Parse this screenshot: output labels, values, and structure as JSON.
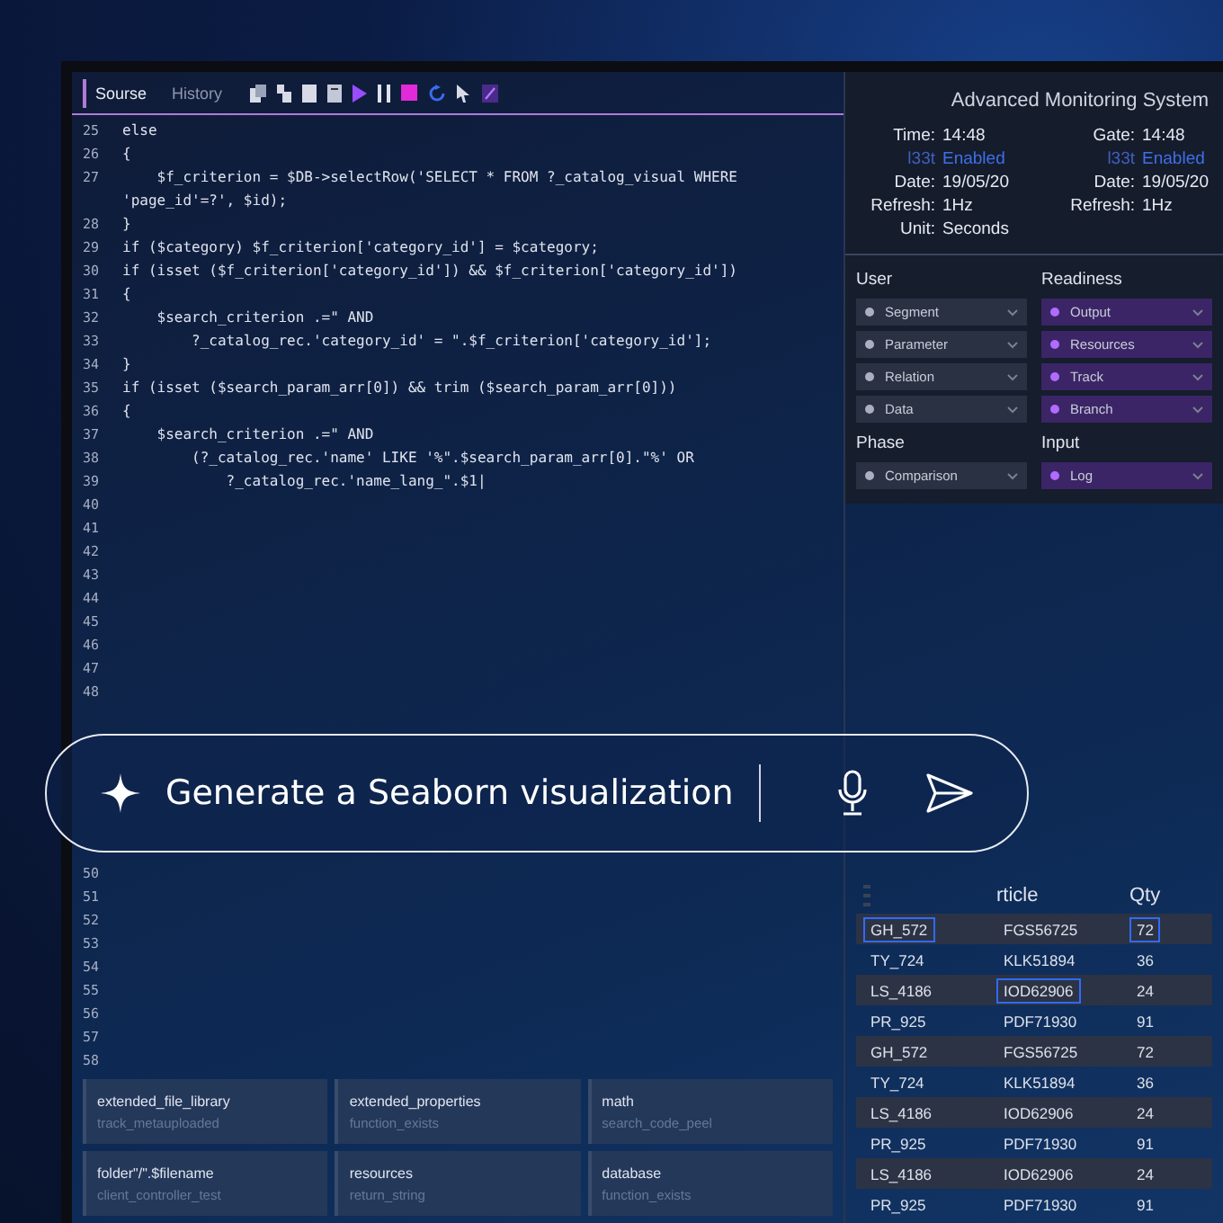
{
  "editor": {
    "tabs": [
      {
        "label": "Sourse",
        "selected": true
      },
      {
        "label": "History",
        "selected": false
      }
    ],
    "lines_above": [
      {
        "number": "25",
        "code": "else"
      },
      {
        "number": "26",
        "code": "{"
      },
      {
        "number": "27",
        "code": "    $f_criterion = $DB->selectRow('SELECT * FROM ?_catalog_visual WHERE 'page_id'=?', $id);"
      },
      {
        "number": "28",
        "code": "}"
      },
      {
        "number": "29",
        "code": "if ($category) $f_criterion['category_id'] = $category;"
      },
      {
        "number": "30",
        "code": "if (isset ($f_criterion['category_id']) && $f_criterion['category_id'])"
      },
      {
        "number": "31",
        "code": "{"
      },
      {
        "number": "32",
        "code": "    $search_criterion .=\" AND"
      },
      {
        "number": "33",
        "code": "        ?_catalog_rec.'category_id' = \".$f_criterion['category_id'];"
      },
      {
        "number": "34",
        "code": "}"
      },
      {
        "number": "35",
        "code": "if (isset ($search_param_arr[0]) && trim ($search_param_arr[0]))"
      },
      {
        "number": "36",
        "code": "{"
      },
      {
        "number": "37",
        "code": "    $search_criterion .=\" AND"
      },
      {
        "number": "38",
        "code": "        (?_catalog_rec.'name' LIKE '%\".$search_param_arr[0].\"%' OR"
      },
      {
        "number": "39",
        "code": "            ?_catalog_rec.'name_lang_\".$1|"
      },
      {
        "number": "40"
      },
      {
        "number": "41"
      },
      {
        "number": "42"
      },
      {
        "number": "43"
      },
      {
        "number": "44"
      },
      {
        "number": "45"
      },
      {
        "number": "46"
      },
      {
        "number": "47"
      },
      {
        "number": "48"
      }
    ],
    "lines_below": [
      {
        "number": "50"
      },
      {
        "number": "51"
      },
      {
        "number": "52"
      },
      {
        "number": "53"
      },
      {
        "number": "54"
      },
      {
        "number": "55"
      },
      {
        "number": "56"
      },
      {
        "number": "57"
      },
      {
        "number": "58"
      }
    ],
    "panels": [
      {
        "title": "extended_file_library",
        "subtitle": "track_metauploaded"
      },
      {
        "title": "folder\"/\".$filename",
        "subtitle": "client_controller_test"
      },
      {
        "title": "extended_properties",
        "subtitle": "function_exists"
      },
      {
        "title": "resources",
        "subtitle": "return_string"
      },
      {
        "title": "math",
        "subtitle": "search_code_peel"
      },
      {
        "title": "database",
        "subtitle": "function_exists"
      }
    ]
  },
  "monitor": {
    "title": "Advanced Monitoring System",
    "left": [
      {
        "label": "Time:",
        "value": "14:48",
        "kind": "plain"
      },
      {
        "label": "l33t",
        "value": "Enabled",
        "kind": "status"
      },
      {
        "label": "Date:",
        "value": "19/05/20",
        "kind": "plain"
      },
      {
        "label": "Refresh:",
        "value": "1Hz",
        "kind": "plain"
      },
      {
        "label": "Unit:",
        "value": "Seconds",
        "kind": "plain"
      }
    ],
    "right": [
      {
        "label": "Gate:",
        "value": "14:48",
        "kind": "plain"
      },
      {
        "label": "l33t",
        "value": "Enabled",
        "kind": "status"
      },
      {
        "label": "Date:",
        "value": "19/05/20",
        "kind": "plain"
      },
      {
        "label": "Refresh:",
        "value": "1Hz",
        "kind": "plain"
      }
    ]
  },
  "groups": [
    {
      "title": "User",
      "kind": "neutral",
      "items": [
        {
          "label": "Segment"
        },
        {
          "label": "Parameter"
        },
        {
          "label": "Relation"
        },
        {
          "label": "Data"
        }
      ]
    },
    {
      "title": "Readiness",
      "kind": "accent",
      "items": [
        {
          "label": "Output"
        },
        {
          "label": "Resources"
        },
        {
          "label": "Track"
        },
        {
          "label": "Branch"
        }
      ]
    },
    {
      "title": "Phase",
      "kind": "neutral",
      "items": [
        {
          "label": "Comparison"
        }
      ]
    },
    {
      "title": "Input",
      "kind": "accent",
      "items": [
        {
          "label": "Log"
        }
      ]
    }
  ],
  "table": {
    "columns": [
      {},
      {
        "label": "rticle"
      },
      {
        "label": "Qty"
      }
    ],
    "rows": [
      {
        "cells": [
          {
            "text": "GH_572",
            "selected": true
          },
          {
            "text": "FGS56725",
            "selected": false
          },
          {
            "text": "72",
            "selected": true
          }
        ]
      },
      {
        "cells": [
          {
            "text": "TY_724",
            "selected": false
          },
          {
            "text": "KLK51894",
            "selected": false
          },
          {
            "text": "36",
            "selected": false
          }
        ]
      },
      {
        "cells": [
          {
            "text": "LS_4186",
            "selected": false
          },
          {
            "text": "IOD62906",
            "selected": true
          },
          {
            "text": "24",
            "selected": false
          }
        ]
      },
      {
        "cells": [
          {
            "text": "PR_925",
            "selected": false
          },
          {
            "text": "PDF71930",
            "selected": false
          },
          {
            "text": "91",
            "selected": false
          }
        ]
      },
      {
        "cells": [
          {
            "text": "GH_572",
            "selected": false
          },
          {
            "text": "FGS56725",
            "selected": false
          },
          {
            "text": "72",
            "selected": false
          }
        ]
      },
      {
        "cells": [
          {
            "text": "TY_724",
            "selected": false
          },
          {
            "text": "KLK51894",
            "selected": false
          },
          {
            "text": "36",
            "selected": false
          }
        ]
      },
      {
        "cells": [
          {
            "text": "LS_4186",
            "selected": false
          },
          {
            "text": "IOD62906",
            "selected": false
          },
          {
            "text": "24",
            "selected": false
          }
        ]
      },
      {
        "cells": [
          {
            "text": "PR_925",
            "selected": false
          },
          {
            "text": "PDF71930",
            "selected": false
          },
          {
            "text": "91",
            "selected": false
          }
        ]
      },
      {
        "cells": [
          {
            "text": "LS_4186",
            "selected": false
          },
          {
            "text": "IOD62906",
            "selected": false
          },
          {
            "text": "24",
            "selected": false
          }
        ]
      },
      {
        "cells": [
          {
            "text": "PR_925",
            "selected": false
          },
          {
            "text": "PDF71930",
            "selected": false
          },
          {
            "text": "91",
            "selected": false
          }
        ]
      }
    ]
  },
  "prompt": {
    "value": "Generate a Seaborn visualization"
  }
}
